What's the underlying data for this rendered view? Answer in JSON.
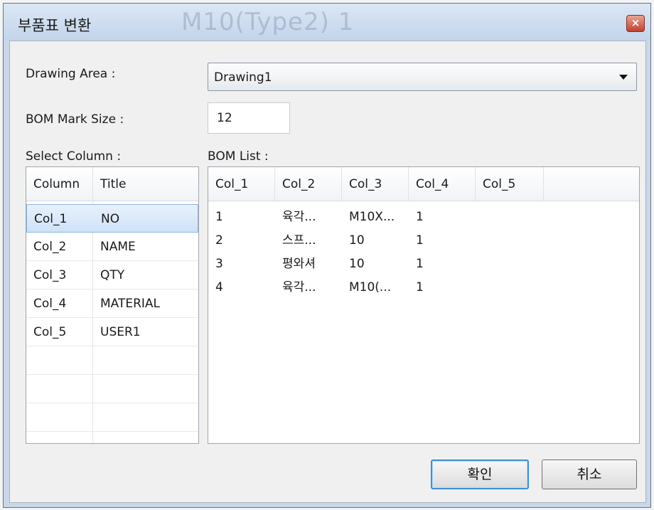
{
  "window": {
    "title": "부품표 변환",
    "bg_ghost_text": "M10(Type2)   1"
  },
  "drawing_area": {
    "label": "Drawing Area :",
    "selected": "Drawing1"
  },
  "bom_mark_size": {
    "label": "BOM Mark Size :",
    "value": "12"
  },
  "select_column": {
    "label": "Select Column :",
    "headers": [
      "Column",
      "Title"
    ],
    "rows": [
      {
        "column": "Col_1",
        "title": "NO"
      },
      {
        "column": "Col_2",
        "title": "NAME"
      },
      {
        "column": "Col_3",
        "title": "QTY"
      },
      {
        "column": "Col_4",
        "title": "MATERIAL"
      },
      {
        "column": "Col_5",
        "title": "USER1"
      }
    ],
    "selected_index": 0
  },
  "bom_list": {
    "label": "BOM List :",
    "headers": [
      "Col_1",
      "Col_2",
      "Col_3",
      "Col_4",
      "Col_5"
    ],
    "rows": [
      [
        "1",
        "육각...",
        "M10X...",
        "1",
        ""
      ],
      [
        "2",
        "스프...",
        "10",
        "1",
        ""
      ],
      [
        "3",
        "평와셔",
        "10",
        "1",
        ""
      ],
      [
        "4",
        "육각...",
        "M10(...",
        "1",
        ""
      ]
    ]
  },
  "buttons": {
    "ok": "확인",
    "cancel": "취소"
  },
  "colors": {
    "title_bar": "#c3d4ea",
    "close_button": "#c0412f",
    "selection": "#cfe2f8",
    "default_button_border": "#3c8fd6"
  }
}
